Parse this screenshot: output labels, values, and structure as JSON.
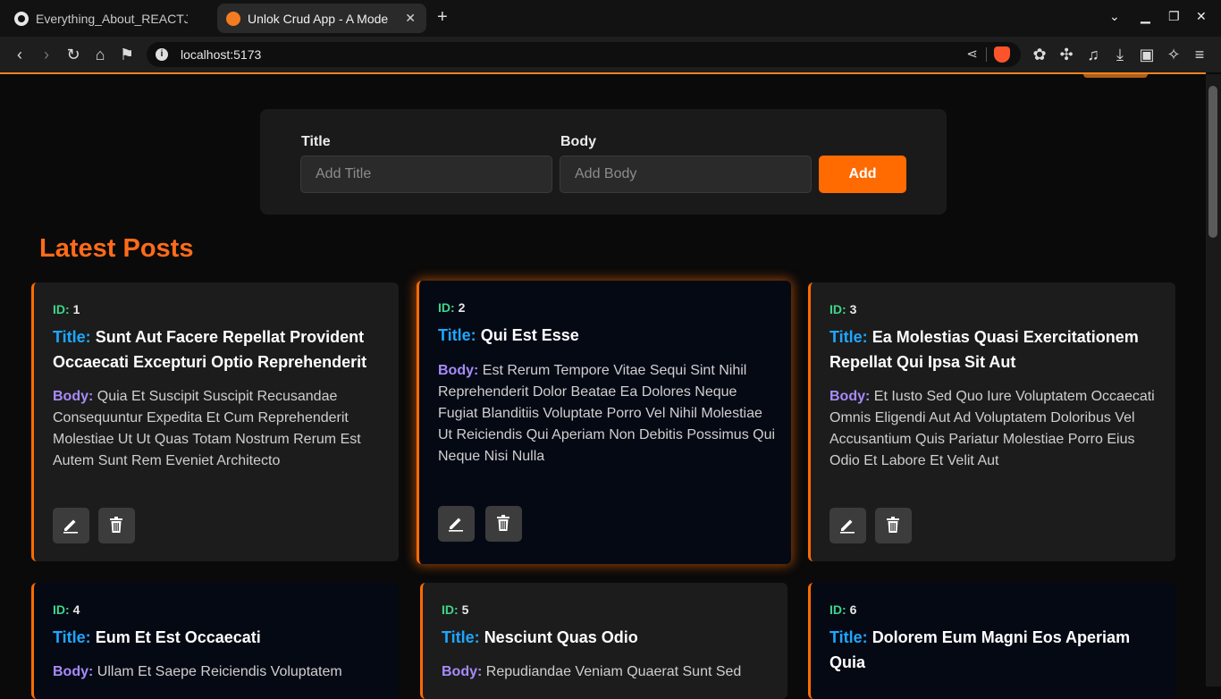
{
  "browser": {
    "tabs": [
      {
        "title": "Everything_About_REACTJS",
        "icon": "github-icon"
      },
      {
        "title": "Unlok Crud App - A Mode",
        "icon": "app-favicon"
      }
    ],
    "url": "localhost:5173"
  },
  "form": {
    "title_label": "Title",
    "title_placeholder": "Add Title",
    "title_value": "",
    "body_label": "Body",
    "body_placeholder": "Add Body",
    "body_value": "",
    "add_label": "Add"
  },
  "section_title": "Latest Posts",
  "labels": {
    "id": "ID:",
    "title": "Title:",
    "body": "Body:"
  },
  "colors": {
    "accent": "#ff6b00",
    "id_label": "#3fd68a",
    "title_label": "#1ea7ff",
    "body_label": "#a78bfa"
  },
  "posts": [
    {
      "id": "1",
      "title": "Sunt Aut Facere Repellat Provident Occaecati Excepturi Optio Reprehenderit",
      "body": "Quia Et Suscipit Suscipit Recusandae Consequuntur Expedita Et Cum Reprehenderit Molestiae Ut Ut Quas Totam Nostrum Rerum Est Autem Sunt Rem Eveniet Architecto"
    },
    {
      "id": "2",
      "title": "Qui Est Esse",
      "body": "Est Rerum Tempore Vitae Sequi Sint Nihil Reprehenderit Dolor Beatae Ea Dolores Neque Fugiat Blanditiis Voluptate Porro Vel Nihil Molestiae Ut Reiciendis Qui Aperiam Non Debitis Possimus Qui Neque Nisi Nulla"
    },
    {
      "id": "3",
      "title": "Ea Molestias Quasi Exercitationem Repellat Qui Ipsa Sit Aut",
      "body": "Et Iusto Sed Quo Iure Voluptatem Occaecati Omnis Eligendi Aut Ad Voluptatem Doloribus Vel Accusantium Quis Pariatur Molestiae Porro Eius Odio Et Labore Et Velit Aut"
    },
    {
      "id": "4",
      "title": "Eum Et Est Occaecati",
      "body": "Ullam Et Saepe Reiciendis Voluptatem"
    },
    {
      "id": "5",
      "title": "Nesciunt Quas Odio",
      "body": "Repudiandae Veniam Quaerat Sunt Sed"
    },
    {
      "id": "6",
      "title": "Dolorem Eum Magni Eos Aperiam Quia",
      "body": ""
    }
  ]
}
